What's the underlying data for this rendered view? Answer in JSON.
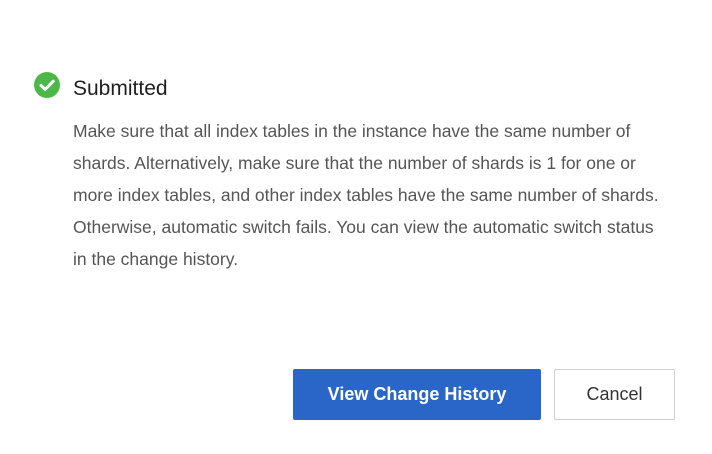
{
  "dialog": {
    "status_icon": "check-circle-icon",
    "status_color": "#4cb84a",
    "title": "Submitted",
    "message": "Make sure that all index tables in the instance have the same number of shards. Alternatively, make sure that the number of shards is 1 for one or more index tables, and other index tables have the same number of shards. Otherwise, automatic switch fails. You can view the automatic switch status in the change history.",
    "primary_button_label": "View Change History",
    "primary_button_color": "#2a66c8",
    "secondary_button_label": "Cancel"
  }
}
